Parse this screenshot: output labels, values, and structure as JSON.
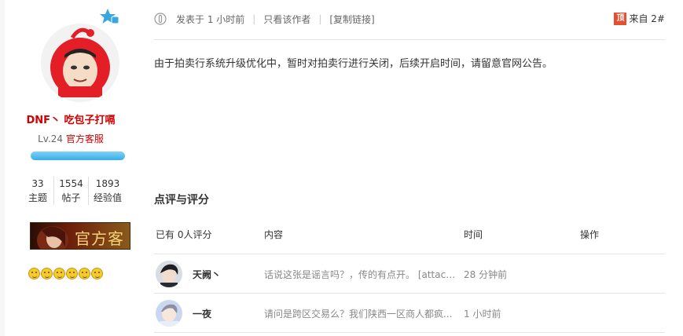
{
  "user": {
    "name": "DNF丶 吃包子打嗝",
    "level": "Lv.24",
    "role": "官方客服",
    "stats": [
      {
        "value": "33",
        "label": "主题"
      },
      {
        "value": "1554",
        "label": "帖子"
      },
      {
        "value": "1893",
        "label": "经验值"
      }
    ],
    "medal_text": "官方客服",
    "smiley_count": 6
  },
  "post": {
    "posted_label": "发表于 1 小时前",
    "author_only": "只看该作者",
    "copy_link": "[复制链接]",
    "top_tag": "顶",
    "floor": "来自 2#",
    "content": "由于拍卖行系统升级优化中，暂时对拍卖行进行关闭，后续开启时间，请留意官网公告。"
  },
  "ratings": {
    "title": "点评与评分",
    "headers": {
      "count": "已有 0人评分",
      "content": "内容",
      "time": "时间",
      "action": "操作"
    },
    "rows": [
      {
        "user": "天阙丶",
        "comment": "话说这张是谣言吗？，传的有点开。 [attachi...",
        "time": "28 分钟前"
      },
      {
        "user": "一夜",
        "comment": "请问是跨区交易么？我们陕西一区商人都疯...",
        "time": "1 小时前"
      }
    ]
  },
  "colors": {
    "accent_red": "#d10000",
    "level_bar": "#38aee6",
    "top_tag": "#e54e2f"
  }
}
